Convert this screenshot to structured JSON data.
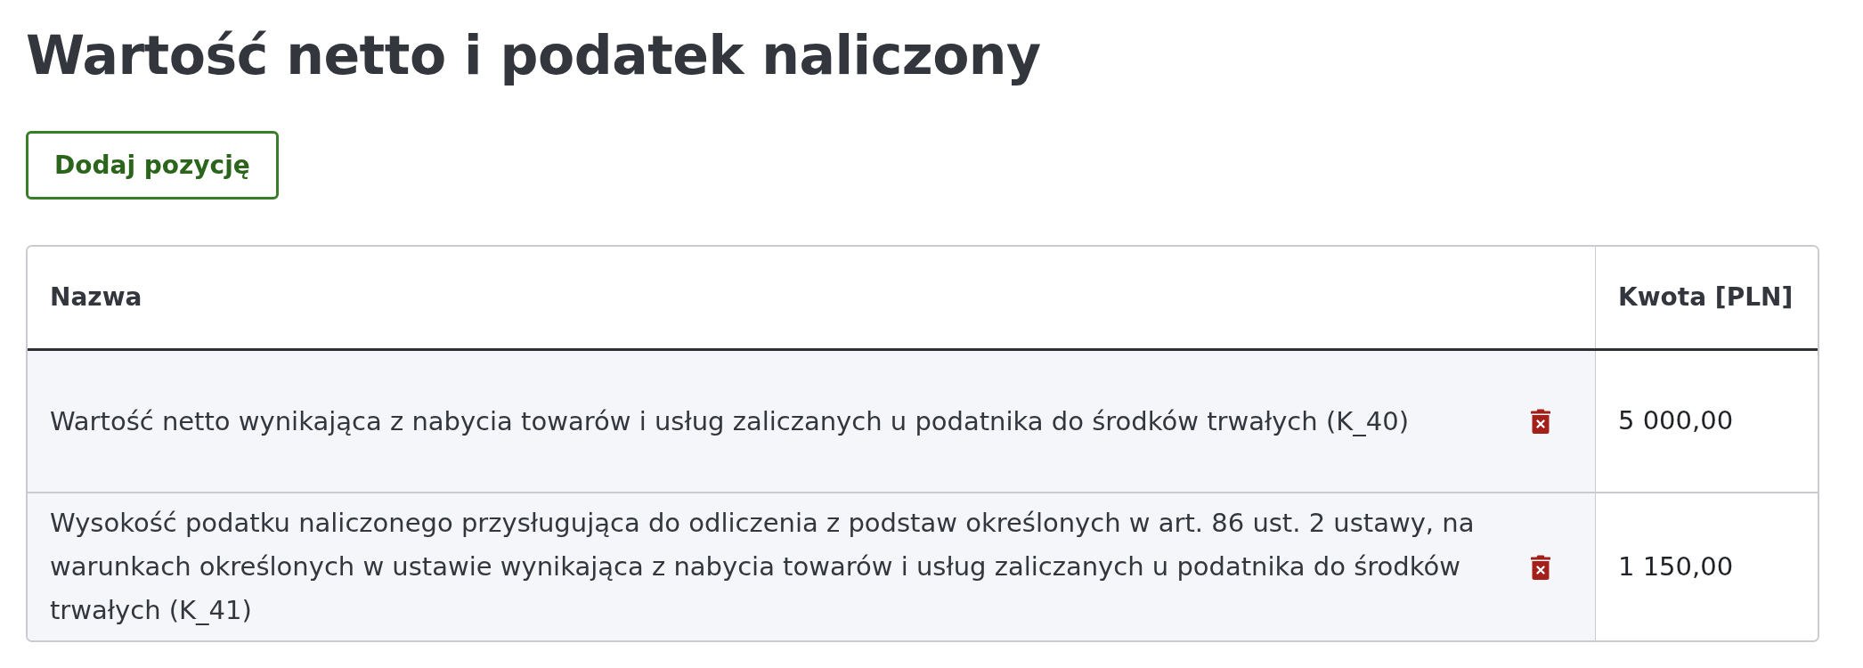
{
  "title": "Wartość netto i podatek naliczony",
  "add_button": {
    "label": "Dodaj pozycję"
  },
  "table": {
    "columns": [
      "Nazwa",
      "Kwota [PLN]"
    ],
    "rows": [
      {
        "name": "Wartość netto wynikająca z nabycia towarów i usług zaliczanych u podatnika do środków trwałych (K_40)",
        "amount": "5 000,00"
      },
      {
        "name": "Wysokość podatku naliczonego przysługująca do odliczenia z podstaw określonych w art. 86 ust. 2 ustawy, na warunkach określonych w ustawie wynikająca z nabycia towarów i usług zaliczanych u podatnika do środków trwałych (K_41)",
        "amount": "1 150,00"
      }
    ]
  }
}
